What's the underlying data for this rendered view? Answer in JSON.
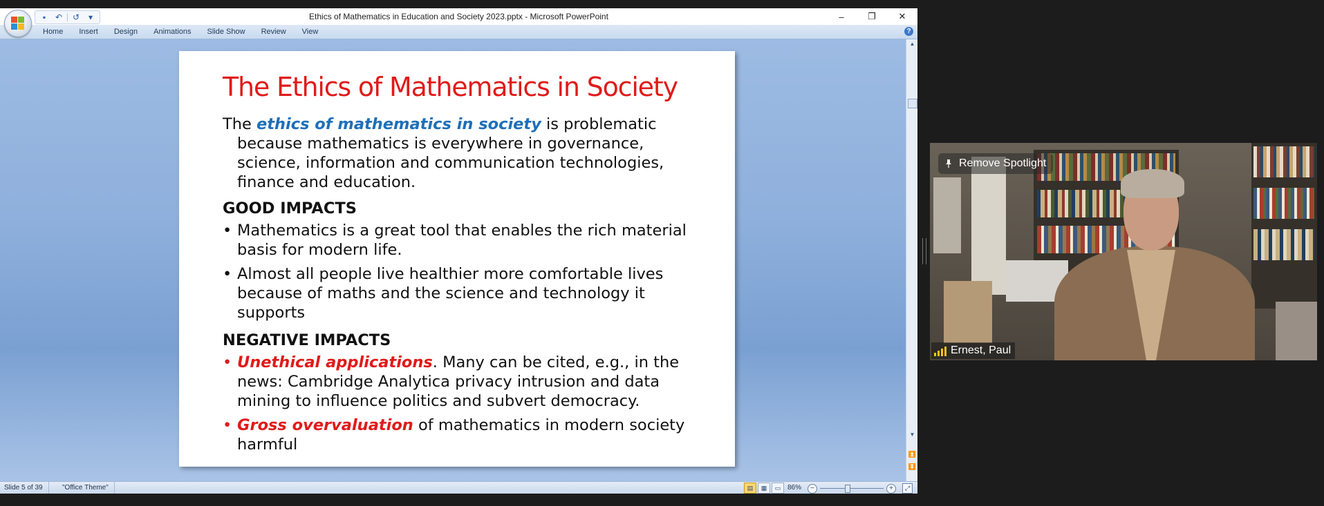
{
  "window": {
    "title": "Ethics of Mathematics in Education and Society 2023.pptx - Microsoft PowerPoint",
    "controls": {
      "minimize": "–",
      "restore": "❐",
      "close": "✕"
    }
  },
  "quick_access": {
    "save": "▪",
    "undo": "↶",
    "redo": "↺",
    "customize": "▾"
  },
  "ribbon": {
    "tabs": [
      "Home",
      "Insert",
      "Design",
      "Animations",
      "Slide Show",
      "Review",
      "View"
    ],
    "help": "?"
  },
  "slide": {
    "title": "The Ethics of Mathematics in Society",
    "intro": {
      "pre": "The ",
      "emphasis": "ethics of mathematics in society",
      "post": " is problematic because mathematics is everywhere in governance, science, information and communication technologies, finance and education."
    },
    "good": {
      "heading": "GOOD IMPACTS",
      "bullets": [
        "Mathematics is a great tool that enables the rich material basis for modern life.",
        "Almost all people live healthier more comfortable lives because of maths and the science and technology it supports"
      ]
    },
    "negative": {
      "heading": "NEGATIVE IMPACTS",
      "bullets": [
        {
          "emphasis": "Unethical applications",
          "rest": ". Many can be cited, e.g., in the news: Cambridge Analytica privacy intrusion and data mining to influence politics and subvert democracy."
        },
        {
          "emphasis": "Gross overvaluation",
          "rest": " of mathematics in modern society harmful"
        }
      ]
    },
    "bullet_char": "•"
  },
  "statusbar": {
    "slide_info": "Slide 5 of 39",
    "theme": "\"Office Theme\"",
    "zoom": "86%",
    "zoom_out": "−",
    "zoom_in": "+"
  },
  "video": {
    "spotlight_label": "Remove Spotlight",
    "participant_name": "Ernest, Paul"
  },
  "colors": {
    "title_red": "#e01a1a",
    "emphasis_blue": "#1e6fb8",
    "signal_yellow": "#f5c518"
  }
}
